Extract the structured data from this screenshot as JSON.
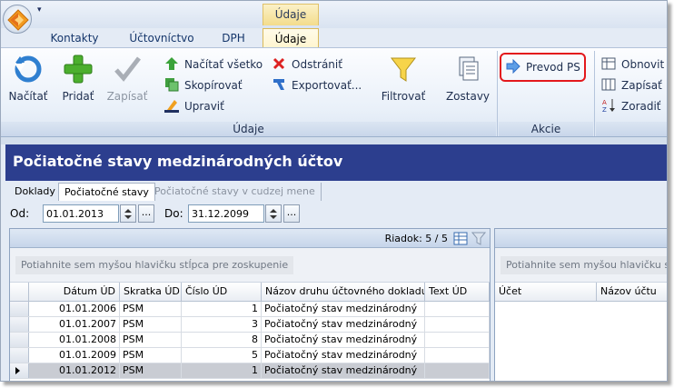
{
  "titlebar": {
    "context_group": "Údaje"
  },
  "tabs": [
    {
      "label": "Kontakty"
    },
    {
      "label": "Účtovníctvo"
    },
    {
      "label": "DPH"
    },
    {
      "label": "Údaje",
      "active": true
    }
  ],
  "ribbon": {
    "udaje_group": {
      "caption": "Údaje",
      "load": "Načítať",
      "add": "Pridať",
      "save": "Zapísať",
      "load_all": "Načítať všetko",
      "copy": "Skopírovať",
      "edit": "Upraviť",
      "remove": "Odstrániť",
      "export": "Exportovať...",
      "filter": "Filtrovať",
      "reports": "Zostavy"
    },
    "akcie_group": {
      "caption": "Akcie",
      "transfer": "Prevod PS"
    },
    "right_group": {
      "refresh": "Obnovit",
      "save": "Zapísať",
      "sort": "Zoradiť"
    }
  },
  "document": {
    "title": "Počiatočné stavy medzinárodných účtov",
    "subtabs": [
      "Doklady",
      "Počiatočné stavy",
      "Počiatočné stavy v cudzej mene"
    ],
    "filter": {
      "from_label": "Od:",
      "from_value": "01.01.2013",
      "to_label": "Do:",
      "to_value": "31.12.2099",
      "dots": "..."
    }
  },
  "grid_left": {
    "rows_label": "Riadok: 5 / 5",
    "group_hint": "Potiahnite sem myšou hlavičku stĺpca pre zoskupenie",
    "columns": [
      "Dátum ÚD",
      "Skratka ÚD",
      "Číslo ÚD",
      "Názov druhu účtovného dokladu",
      "Text ÚD"
    ],
    "rows": [
      {
        "date": "01.01.2006",
        "abbr": "PSM",
        "num": "1",
        "type": "Počiatočný stav medzinárodný",
        "text": ""
      },
      {
        "date": "01.01.2007",
        "abbr": "PSM",
        "num": "3",
        "type": "Počiatočný stav medzinárodný",
        "text": ""
      },
      {
        "date": "01.01.2008",
        "abbr": "PSM",
        "num": "8",
        "type": "Počiatočný stav medzinárodný",
        "text": ""
      },
      {
        "date": "01.01.2009",
        "abbr": "PSM",
        "num": "5",
        "type": "Počiatočný stav medzinárodný",
        "text": ""
      },
      {
        "date": "01.01.2012",
        "abbr": "PSM",
        "num": "1",
        "type": "Počiatočný stav medzinárodný",
        "text": ""
      }
    ]
  },
  "grid_right": {
    "group_hint": "Potiahnite sem myšou hlavičku s",
    "columns": [
      "Účet",
      "Názov účtu"
    ]
  }
}
